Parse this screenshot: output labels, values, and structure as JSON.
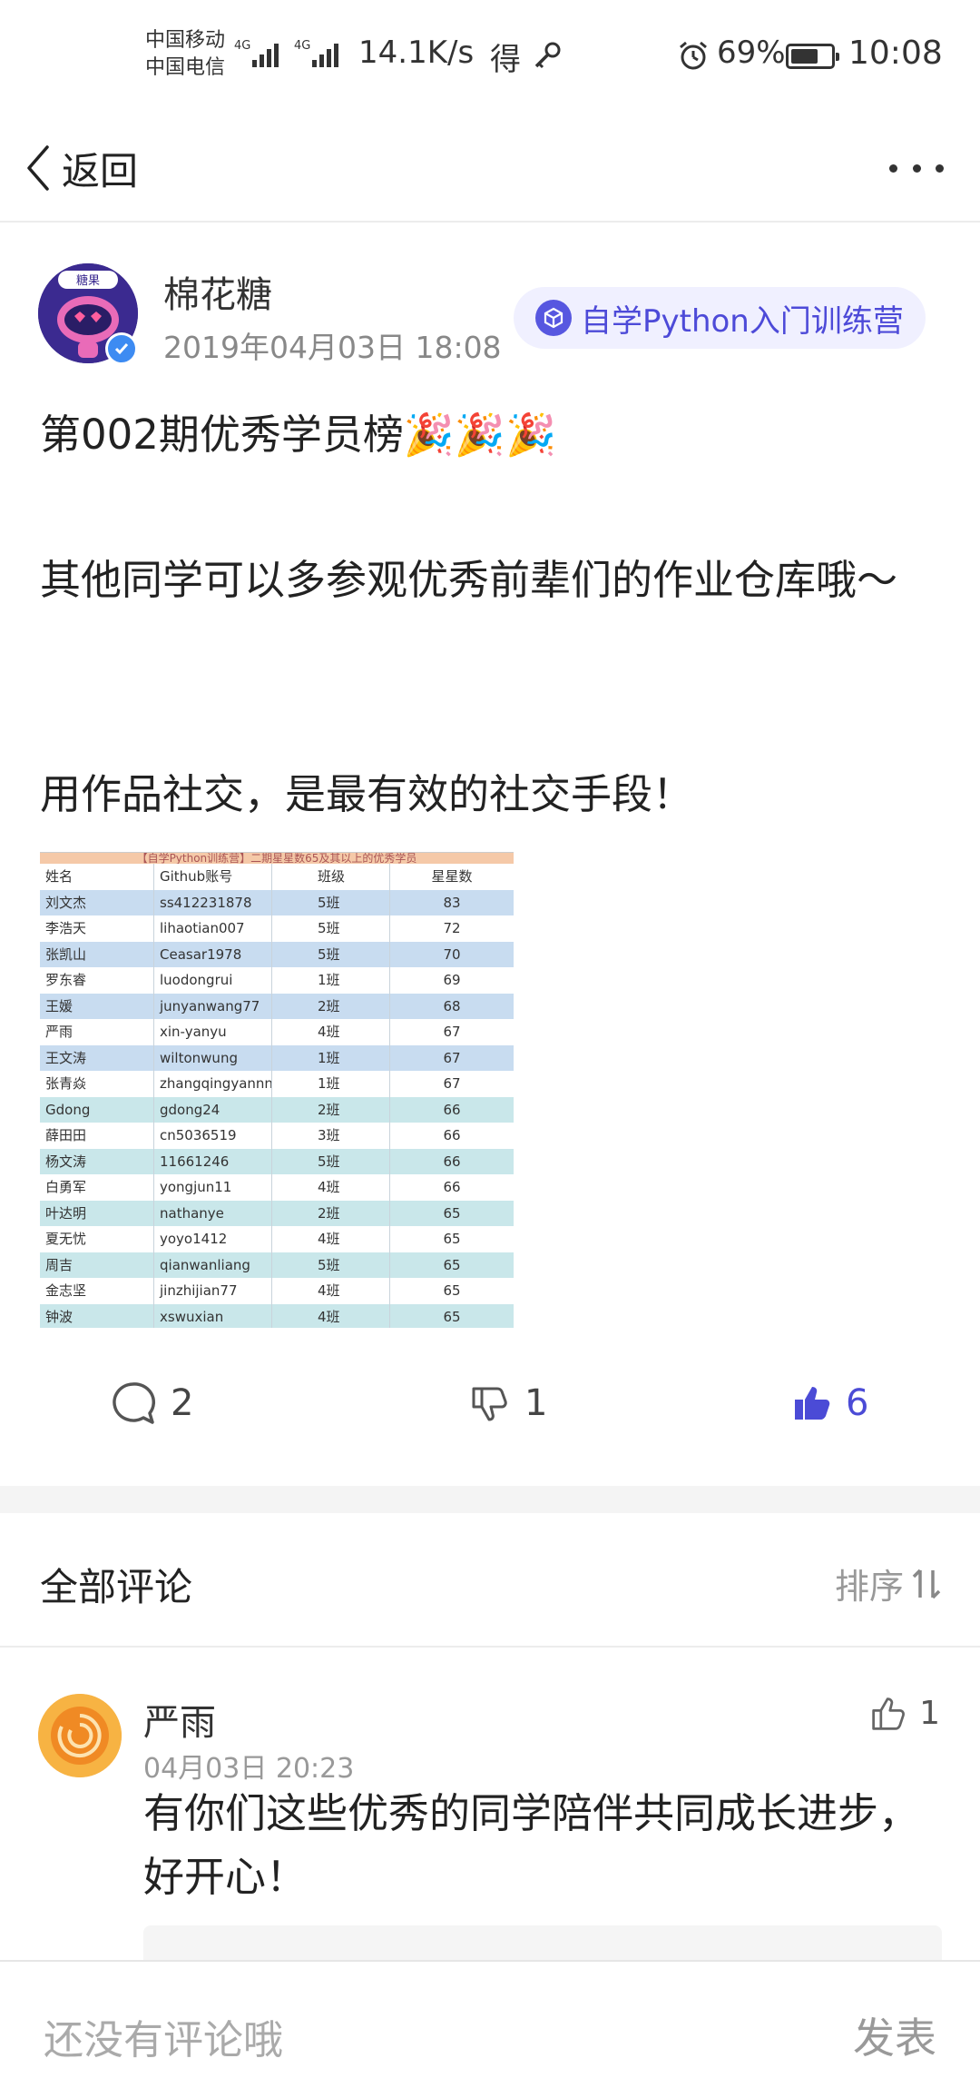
{
  "status_bar": {
    "carrier_1": "中国移动",
    "carrier_2": "中国电信",
    "network_1": "4G",
    "network_2": "4G",
    "speed": "14.1K/s",
    "app_icon_text": "得",
    "battery": "69%",
    "battery_level": 0.69,
    "time": "10:08"
  },
  "navbar": {
    "back_label": "返回"
  },
  "post": {
    "author": "棉花糖",
    "avatar_badge": "糖果",
    "date": "2019年04月03日 18:08",
    "tag": "自学Python入门训练营",
    "line_1": "第002期优秀学员榜🎉🎉🎉",
    "line_2": "其他同学可以多参观优秀前辈们的作业仓库哦～",
    "line_3": "用作品社交，是最有效的社交手段！"
  },
  "table_image": {
    "title": "【自学Python训练营】二期星星数65及其以上的优秀学员",
    "headers": [
      "姓名",
      "Github账号",
      "班级",
      "星星数"
    ],
    "rows": [
      [
        "刘文杰",
        "ss412231878",
        "5班",
        "83"
      ],
      [
        "李浩天",
        "lihaotian007",
        "5班",
        "72"
      ],
      [
        "张凯山",
        "Ceasar1978",
        "5班",
        "70"
      ],
      [
        "罗东睿",
        "luodongrui",
        "1班",
        "69"
      ],
      [
        "王媛",
        "junyanwang77",
        "2班",
        "68"
      ],
      [
        "严雨",
        "xin-yanyu",
        "4班",
        "67"
      ],
      [
        "王文涛",
        "wiltonwung",
        "1班",
        "67"
      ],
      [
        "张青焱",
        "zhangqingyannn",
        "1班",
        "67"
      ],
      [
        "Gdong",
        "gdong24",
        "2班",
        "66"
      ],
      [
        "薛田田",
        "cn5036519",
        "3班",
        "66"
      ],
      [
        "杨文涛",
        "11661246",
        "5班",
        "66"
      ],
      [
        "白勇军",
        "yongjun11",
        "4班",
        "66"
      ],
      [
        "叶达明",
        "nathanye",
        "2班",
        "65"
      ],
      [
        "夏无忧",
        "yoyo1412",
        "4班",
        "65"
      ],
      [
        "周吉",
        "qianwanliang",
        "5班",
        "65"
      ],
      [
        "金志坚",
        "jinzhijian77",
        "4班",
        "65"
      ],
      [
        "钟波",
        "xswuxian",
        "4班",
        "65"
      ]
    ]
  },
  "actions": {
    "comments_count": "2",
    "dislike_count": "1",
    "like_count": "6"
  },
  "comments": {
    "title": "全部评论",
    "sort_label": "排序",
    "items": [
      {
        "name": "严雨",
        "date": "04月03日 20:23",
        "likes": "1",
        "text": "有你们这些优秀的同学陪伴共同成长进步，好开心！"
      }
    ]
  },
  "bottom_bar": {
    "placeholder": "还没有评论哦",
    "publish_label": "发表"
  },
  "colors": {
    "accent": "#4b4bd6",
    "tag_bg": "#f0f0ff",
    "row_blue": "#c8dcf0",
    "row_teal": "#c9e7ea"
  }
}
